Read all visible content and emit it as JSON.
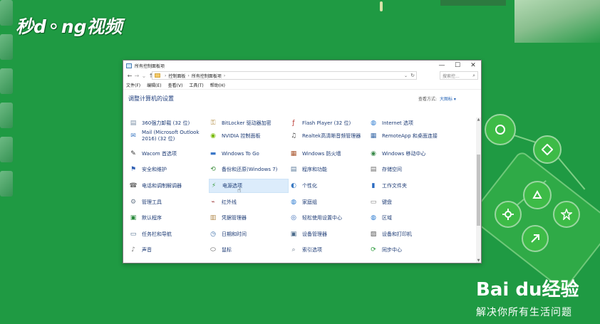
{
  "watermark": {
    "top_left_logo": "秒d⚬ng视频",
    "brand": "Bai du经验",
    "slogan": "解决你所有生活问题"
  },
  "window": {
    "title": "所有控制面板项",
    "controls": [
      "—",
      "☐",
      "✕"
    ],
    "nav": {
      "back": "←",
      "forward": "→",
      "down": "⌄",
      "up": "↑"
    },
    "address": [
      "控制面板",
      "所有控制面板项"
    ],
    "address_caret": "⌄",
    "refresh": "↻",
    "search_placeholder": "搜索控...",
    "search_icon": "⌕",
    "menu": [
      "文件(F)",
      "编辑(E)",
      "查看(V)",
      "工具(T)",
      "帮助(H)"
    ],
    "heading": "调整计算机的设置",
    "view_by_label": "查看方式:",
    "view_by_value": "大图标 ▾"
  },
  "items": [
    [
      {
        "label": "360强力卸载 (32 位)",
        "icon": "uninstall-icon",
        "glyph": "▤",
        "color": "#7a8fa6"
      },
      {
        "label": "Mail (Microsoft Outlook 2016) (32 位)",
        "icon": "mail-icon",
        "glyph": "✉",
        "color": "#3a78c2"
      },
      {
        "label": "Wacom 首选项",
        "icon": "wacom-icon",
        "glyph": "✎",
        "color": "#333333"
      },
      {
        "label": "安全和维护",
        "icon": "flag-icon",
        "glyph": "⚑",
        "color": "#2f5fb3"
      },
      {
        "label": "电话和调制解调器",
        "icon": "phone-icon",
        "glyph": "☎",
        "color": "#6a6a6a"
      },
      {
        "label": "管理工具",
        "icon": "admin-tools-icon",
        "glyph": "⚙",
        "color": "#6b7b8c"
      },
      {
        "label": "默认程序",
        "icon": "default-programs-icon",
        "glyph": "▣",
        "color": "#2a8a3c"
      },
      {
        "label": "任务栏和导航",
        "icon": "taskbar-icon",
        "glyph": "▭",
        "color": "#4a6a8a"
      },
      {
        "label": "声音",
        "icon": "sound-icon",
        "glyph": "♪",
        "color": "#777777"
      }
    ],
    [
      {
        "label": "BitLocker 驱动器加密",
        "icon": "bitlocker-icon",
        "glyph": "⚿",
        "color": "#b08a3e"
      },
      {
        "label": "NVIDIA 控制面板",
        "icon": "nvidia-icon",
        "glyph": "◉",
        "color": "#76b900"
      },
      {
        "label": "Windows To Go",
        "icon": "windows-to-go-icon",
        "glyph": "▬",
        "color": "#3c78c8"
      },
      {
        "label": "备份和还原(Windows 7)",
        "icon": "backup-icon",
        "glyph": "⟲",
        "color": "#3a8c3a"
      },
      {
        "label": "电源选项",
        "icon": "power-options-icon",
        "glyph": "⚡",
        "color": "#3b9c3b"
      },
      {
        "label": "红外线",
        "icon": "infrared-icon",
        "glyph": "⌁",
        "color": "#a04040"
      },
      {
        "label": "凭据管理器",
        "icon": "credential-icon",
        "glyph": "▥",
        "color": "#b0884a"
      },
      {
        "label": "日期和时间",
        "icon": "clock-icon",
        "glyph": "◷",
        "color": "#3c6ea8"
      },
      {
        "label": "鼠标",
        "icon": "mouse-icon",
        "glyph": "⬭",
        "color": "#555555"
      }
    ],
    [
      {
        "label": "Flash Player (32 位)",
        "icon": "flash-icon",
        "glyph": "ƒ",
        "color": "#b8322a"
      },
      {
        "label": "Realtek高清晰音频管理器",
        "icon": "realtek-icon",
        "glyph": "♫",
        "color": "#444444"
      },
      {
        "label": "Windows 防火墙",
        "icon": "firewall-icon",
        "glyph": "▦",
        "color": "#a8542c"
      },
      {
        "label": "程序和功能",
        "icon": "programs-icon",
        "glyph": "▤",
        "color": "#5a7a9a"
      },
      {
        "label": "个性化",
        "icon": "personalize-icon",
        "glyph": "◐",
        "color": "#3a7ac2"
      },
      {
        "label": "家庭组",
        "icon": "homegroup-icon",
        "glyph": "◍",
        "color": "#2a7ad0"
      },
      {
        "label": "轻松使用设置中心",
        "icon": "ease-of-access-icon",
        "glyph": "◎",
        "color": "#2a5fb0"
      },
      {
        "label": "设备管理器",
        "icon": "device-manager-icon",
        "glyph": "▣",
        "color": "#4a6a8a"
      },
      {
        "label": "索引选项",
        "icon": "indexing-icon",
        "glyph": "⌕",
        "color": "#6a7a8a"
      }
    ],
    [
      {
        "label": "Internet 选项",
        "icon": "internet-icon",
        "glyph": "◍",
        "color": "#2a7ad0"
      },
      {
        "label": "RemoteApp 和桌面连接",
        "icon": "remoteapp-icon",
        "glyph": "▦",
        "color": "#3a6aa8"
      },
      {
        "label": "Windows 移动中心",
        "icon": "mobility-center-icon",
        "glyph": "◉",
        "color": "#3a8a4a"
      },
      {
        "label": "存储空间",
        "icon": "storage-icon",
        "glyph": "▤",
        "color": "#6a6a6a"
      },
      {
        "label": "工作文件夹",
        "icon": "work-folders-icon",
        "glyph": "▮",
        "color": "#2a6ac0"
      },
      {
        "label": "键盘",
        "icon": "keyboard-icon",
        "glyph": "▭",
        "color": "#777777"
      },
      {
        "label": "区域",
        "icon": "region-icon",
        "glyph": "◍",
        "color": "#2a7ad0"
      },
      {
        "label": "设备和打印机",
        "icon": "printer-icon",
        "glyph": "▨",
        "color": "#555555"
      },
      {
        "label": "同步中心",
        "icon": "sync-icon",
        "glyph": "⟳",
        "color": "#2a9a3a"
      }
    ]
  ],
  "selected_item": "电源选项"
}
